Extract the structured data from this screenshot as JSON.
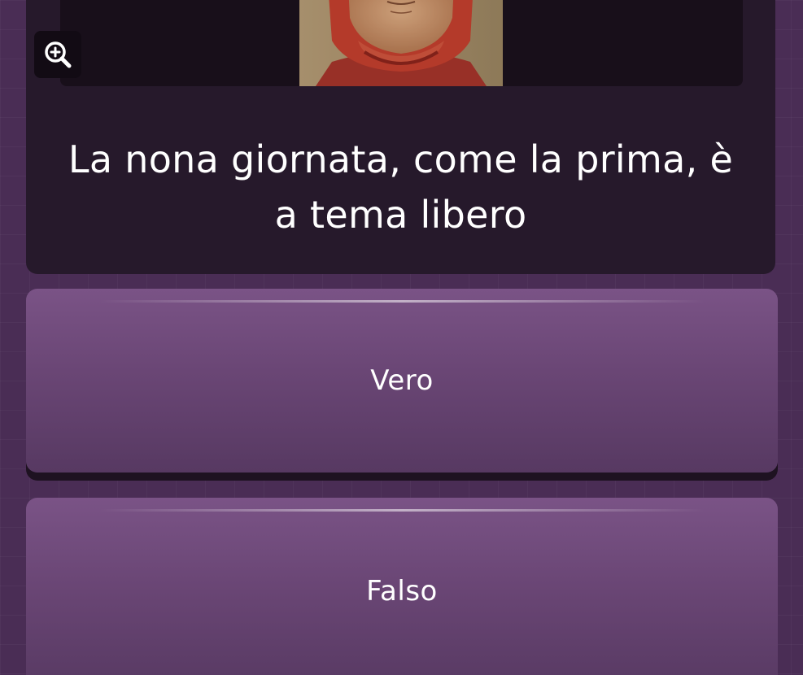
{
  "question": {
    "text": "La nona giornata, come la prima, è a tema libero",
    "zoom_icon": "zoom-in-icon",
    "image": "portrait-image"
  },
  "answers": [
    {
      "label": "Vero"
    },
    {
      "label": "Falso"
    }
  ],
  "colors": {
    "background": "#4a2d55",
    "card": "#26192b",
    "answer_top": "#7a5386",
    "answer_bottom": "#573962",
    "text": "#ffffff"
  }
}
